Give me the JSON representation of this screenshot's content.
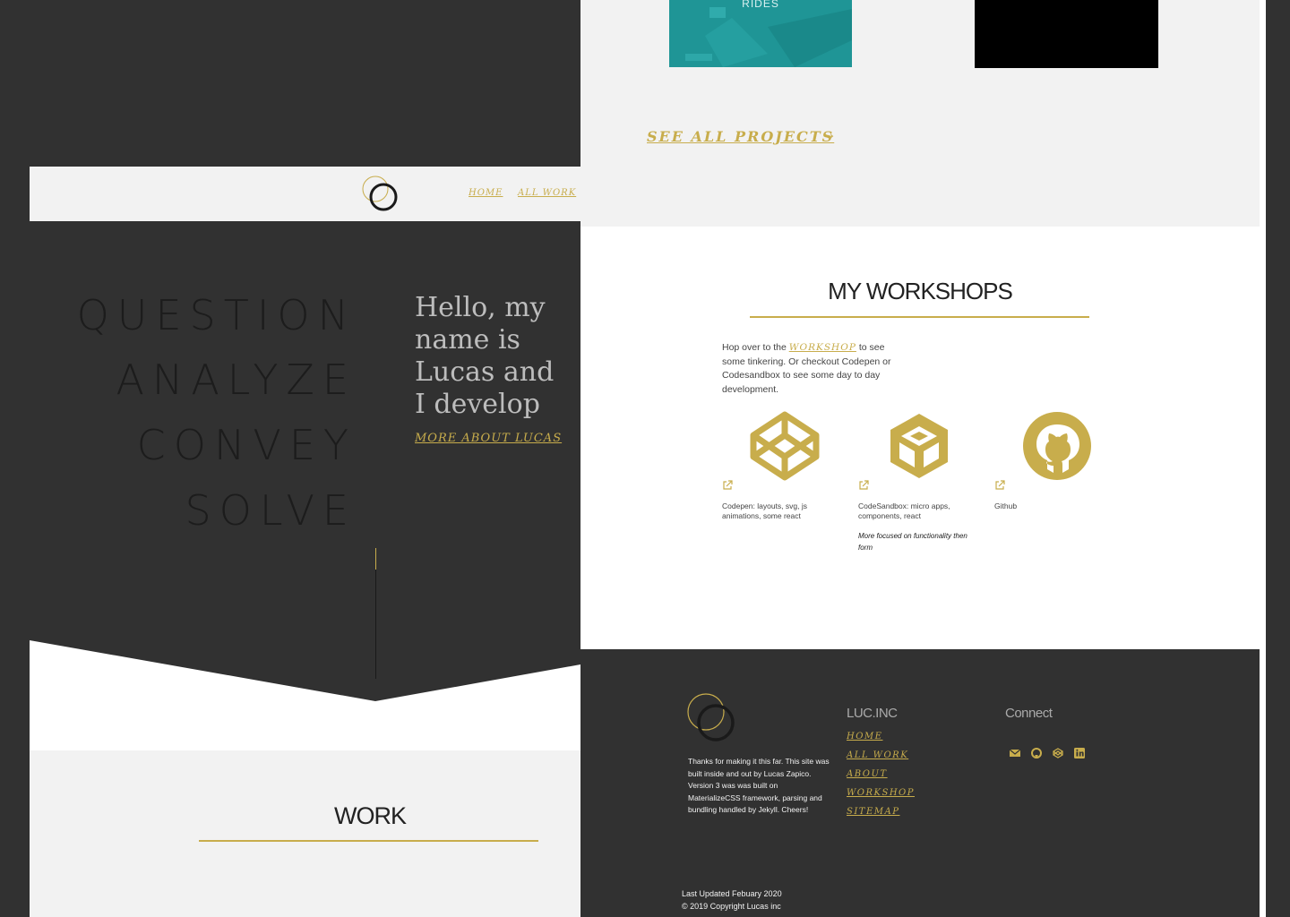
{
  "left_nav": {
    "logo": "circle-logo-icon",
    "links": [
      "HOME",
      "ALL WORK"
    ]
  },
  "hero": {
    "words": [
      "QUESTION",
      "ANALYZE",
      "CONVEY",
      "SOLVE"
    ],
    "intro": "Hello, my name is Lucas and I develop",
    "more_link": "MORE ABOUT LUCAS"
  },
  "work": {
    "title": "WORK"
  },
  "projects": {
    "rides_label": "RIDES",
    "see_all": "SEE ALL PROJECTS",
    "see_all_icon": "arrow-right-icon"
  },
  "workshops": {
    "title": "MY WORKSHOPS",
    "text_before": "Hop over to the ",
    "workshop_link": "WORKSHOP",
    "text_after": " to see some tinkering. Or checkout Codepen or Codesandbox to see some day to day development.",
    "cards": [
      {
        "icon": "codepen-icon",
        "caption": "Codepen: layouts, svg, js animations, some react",
        "note": ""
      },
      {
        "icon": "codesandbox-icon",
        "caption": "CodeSandbox: micro apps, components, react",
        "note": "More focused on functionality then form"
      },
      {
        "icon": "github-icon",
        "caption": "Github",
        "note": ""
      }
    ]
  },
  "footer": {
    "about": "Thanks for making it this far. This site was built inside and out by Lucas Zapico. Version 3 was was built on MaterializeCSS framework, parsing and bundling handled by Jekyll. Cheers!",
    "brand_heading": "LUC.INC",
    "links": [
      "HOME",
      "ALL WORK",
      "ABOUT",
      "WORKSHOP",
      "SITEMAP"
    ],
    "connect_heading": "Connect",
    "social_icons": [
      "envelope-icon",
      "github-icon",
      "codepen-icon",
      "linkedin-icon"
    ],
    "updated": "Last Updated Febuary 2020",
    "copyright": "© 2019 Copyright Lucas inc"
  },
  "colors": {
    "accent": "#c8ad4c",
    "dark": "#313131",
    "light": "#f2f2f2",
    "teal": "#1f9596"
  }
}
